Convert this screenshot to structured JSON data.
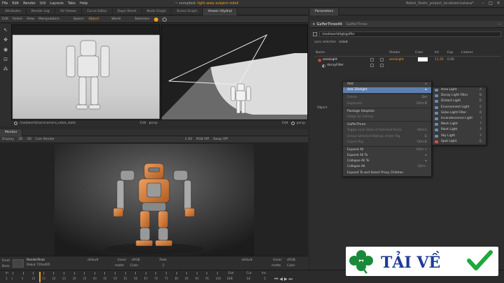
{
  "menubar": {
    "items": [
      "File",
      "Edit",
      "Render",
      "Util",
      "Layouts",
      "Tabs",
      "Help"
    ],
    "title_prefix": "~ compiled: ",
    "title_highlight": "light-area subject-robot",
    "project": "Robot_Static_project_localized.katana*"
  },
  "left_tabs": [
    "Attributes",
    "Render Log",
    "UV Viewer",
    "Curve Editor",
    "Dope Sheet",
    "Node Graph",
    "Scene Graph",
    "Viewer (Hydra)"
  ],
  "viewer_toolbar": [
    "Edit",
    "Select",
    "View",
    "Manipulators",
    "Space:",
    "Object",
    "World",
    "Selection"
  ],
  "viewport_left_footer": {
    "left": "/root/world/cam/camera_robot_static",
    "right_a": "Edit",
    "right_b": "persp"
  },
  "viewport_right_footer": {
    "right_a": "Edit",
    "right_b": "persp"
  },
  "monitor": {
    "tab": "Monitor",
    "toolbar": [
      "Display",
      "2D",
      "3D",
      "Live Render"
    ],
    "toolbar_right": [
      "1.00",
      "RGB Off",
      "Swap Off"
    ]
  },
  "params": {
    "tab": "Parameters",
    "node_name": "GafferThree44",
    "node_type": "GafferThree",
    "path": "/root/world/lgt/gaffer",
    "sync_label": "sync selection",
    "sync_value": "in/out",
    "columns": [
      "Name",
      "Shader",
      "Color",
      "Int",
      "Exp",
      "Linkens"
    ],
    "rows": [
      {
        "name": "areaLight",
        "shader": "areaLight",
        "int": "11.20",
        "exp": "0.00"
      },
      {
        "name": "decayFilter",
        "shader": "",
        "int": "",
        "exp": ""
      }
    ],
    "object_label": "Object"
  },
  "context_menu": {
    "items": [
      {
        "label": "Add",
        "shortcut": "",
        "state": "normal"
      },
      {
        "label": "Add 3Delight",
        "shortcut": "",
        "state": "highlight"
      },
      {
        "label": "Delete",
        "shortcut": "Del",
        "state": "disabled"
      },
      {
        "label": "Duplicate",
        "shortcut": "Ctrl+D",
        "state": "disabled"
      },
      {
        "label": "Package Adoption",
        "shortcut": "",
        "state": "normal"
      },
      {
        "label": "Adopt for Editing",
        "shortcut": "",
        "state": "disabled"
      },
      {
        "label": "GafferThree",
        "shortcut": "",
        "state": "normal"
      },
      {
        "label": "Toggle Lock State of Selected Items",
        "shortcut": "Ctrl+L",
        "state": "disabled"
      },
      {
        "label": "Group Selected Siblings Under Rig",
        "shortcut": "G",
        "state": "disabled"
      },
      {
        "label": "Export Rig",
        "shortcut": "Ctrl+E",
        "state": "disabled"
      },
      {
        "label": "Expand All",
        "shortcut": "Ctrl++",
        "state": "normal"
      },
      {
        "label": "Expand All To",
        "shortcut": "",
        "state": "normal"
      },
      {
        "label": "Collapse All To",
        "shortcut": "",
        "state": "normal"
      },
      {
        "label": "Collapse All",
        "shortcut": "Ctrl+-",
        "state": "normal"
      },
      {
        "label": "Expand To and Select Proxy Children",
        "shortcut": "",
        "state": "normal"
      }
    ],
    "submenu": [
      {
        "label": "Area Light",
        "shortcut": "A"
      },
      {
        "label": "Decay Light Filter",
        "shortcut": "N"
      },
      {
        "label": "Distant Light",
        "shortcut": "D"
      },
      {
        "label": "Environment Light",
        "shortcut": "E"
      },
      {
        "label": "Gobo Light Filter",
        "shortcut": "B"
      },
      {
        "label": "Incandescence Light",
        "shortcut": "I"
      },
      {
        "label": "Mesh Light",
        "shortcut": "T"
      },
      {
        "label": "Point Light",
        "shortcut": "P"
      },
      {
        "label": "Sky Light",
        "shortcut": "Y"
      },
      {
        "label": "Spot Light",
        "shortcut": "Q"
      }
    ]
  },
  "bottom": {
    "front_label": "Front",
    "back_label": "Back",
    "render_name": "RenderFinal",
    "render_sub": "Robot 720x405",
    "default": "default",
    "linear": "linear",
    "srgb": "sRGB",
    "matte": "matte",
    "color": "Color",
    "rate_label": "Rate",
    "rate_value": "2"
  },
  "timeline": {
    "in_label": "In",
    "in_value": "1",
    "ticks": [
      "1",
      "5",
      "10",
      "15",
      "20",
      "25",
      "30",
      "35",
      "40",
      "45",
      "50",
      "55",
      "60",
      "65",
      "70",
      "75",
      "80",
      "85",
      "90",
      "95",
      "100"
    ],
    "out_label": "Out",
    "out_value": "100",
    "cur_label": "Cur",
    "cur_value": "14",
    "inc_label": "Inc",
    "inc_value": "1",
    "current_frame": 14
  },
  "watermark": {
    "text": "TẢI VỀ",
    "text_color": "#1f3a93",
    "clover_color": "#1a8a3a",
    "check_color": "#1fa83c"
  },
  "colors": {
    "accent": "#f0a020",
    "highlight": "#5f7fb0",
    "robot_orange": "#d8823a"
  }
}
